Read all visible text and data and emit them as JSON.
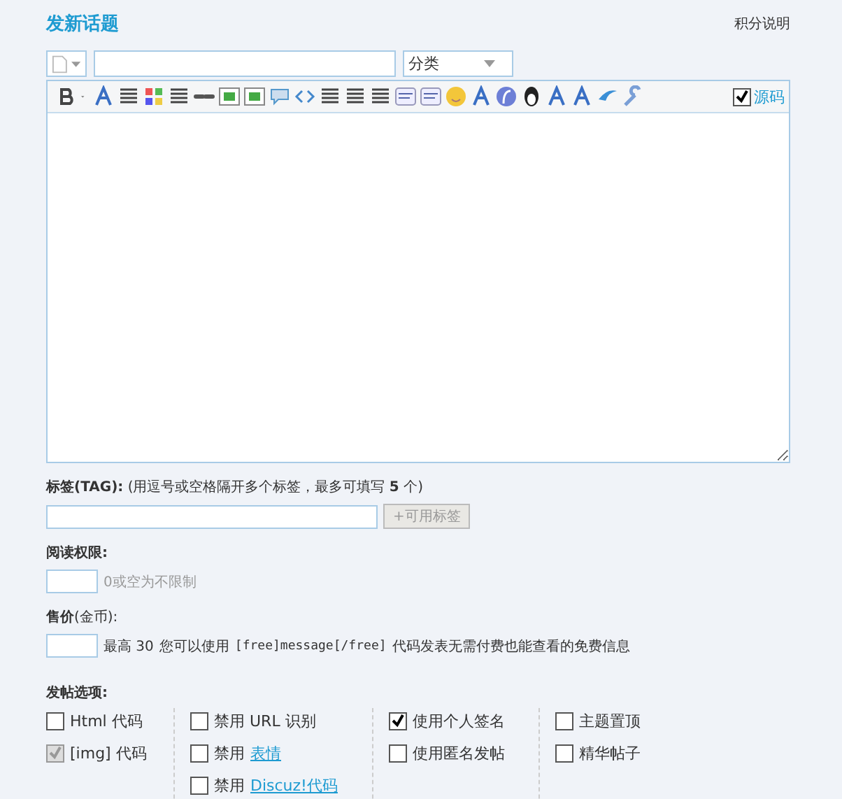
{
  "header": {
    "title": "发新话题",
    "help_link": "积分说明"
  },
  "subject_row": {
    "category": {
      "value": "分类"
    }
  },
  "editor": {
    "source_mode": {
      "label": "源码",
      "checked": true
    }
  },
  "tags": {
    "label": "标签(TAG):",
    "hint": "(用逗号或空格隔开多个标签，最多可填写 **5** 个)",
    "button": "+可用标签"
  },
  "read_permission": {
    "label": "阅读权限:",
    "hint": "0或空为不限制"
  },
  "price": {
    "label": "售价",
    "unit": "(金币):",
    "max_label": "最高 30",
    "info_prefix": "您可以使用",
    "code": "[free]message[/free]",
    "info_suffix": "代码发表无需付费也能查看的免费信息"
  },
  "options": {
    "label": "发帖选项:",
    "columns": [
      [
        {
          "label": "Html 代码",
          "checked": false,
          "disabled": false
        },
        {
          "label": "[img] 代码",
          "checked": true,
          "disabled": true
        }
      ],
      [
        {
          "label": "禁用 URL 识别",
          "checked": false,
          "disabled": false
        },
        {
          "prefix": "禁用",
          "link": "表情",
          "checked": false,
          "disabled": false
        },
        {
          "prefix": "禁用",
          "link": "Discuz!代码",
          "checked": false,
          "disabled": false
        }
      ],
      [
        {
          "label": "使用个人签名",
          "checked": true,
          "disabled": false
        },
        {
          "label": "使用匿名发帖",
          "checked": false,
          "disabled": false
        }
      ],
      [
        {
          "label": "主题置顶",
          "checked": false,
          "disabled": false
        },
        {
          "label": "精华帖子",
          "checked": false,
          "disabled": false
        }
      ]
    ]
  }
}
